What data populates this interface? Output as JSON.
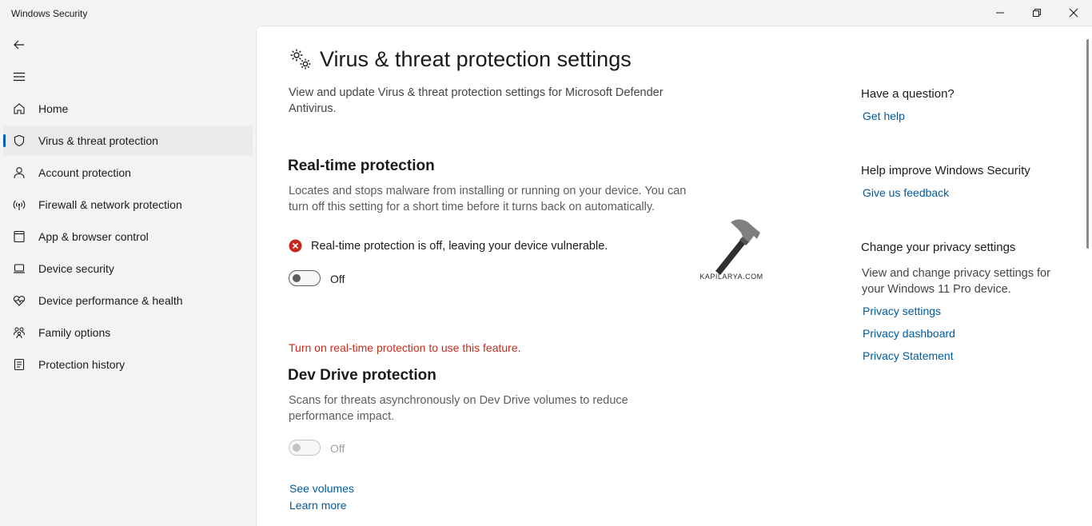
{
  "window": {
    "title": "Windows Security"
  },
  "sidebar": {
    "items": [
      {
        "label": "Home",
        "icon": "home-icon"
      },
      {
        "label": "Virus & threat protection",
        "icon": "shield-icon",
        "active": true
      },
      {
        "label": "Account protection",
        "icon": "person-icon"
      },
      {
        "label": "Firewall & network protection",
        "icon": "wifi-icon"
      },
      {
        "label": "App & browser control",
        "icon": "app-window-icon"
      },
      {
        "label": "Device security",
        "icon": "laptop-icon"
      },
      {
        "label": "Device performance & health",
        "icon": "heart-pulse-icon"
      },
      {
        "label": "Family options",
        "icon": "family-icon"
      },
      {
        "label": "Protection history",
        "icon": "history-icon"
      }
    ]
  },
  "main": {
    "title": "Virus & threat protection settings",
    "subtitle": "View and update Virus & threat protection settings for Microsoft Defender Antivirus.",
    "realtime": {
      "title": "Real-time protection",
      "description": "Locates and stops malware from installing or running on your device. You can turn off this setting for a short time before it turns back on automatically.",
      "warning": "Real-time protection is off, leaving your device vulnerable.",
      "toggle_label": "Off",
      "toggle_on": false
    },
    "note": "Turn on real-time protection to use this feature.",
    "devdrive": {
      "title": "Dev Drive protection",
      "description": "Scans for threats asynchronously on Dev Drive volumes to reduce performance impact.",
      "toggle_label": "Off",
      "toggle_on": false,
      "enabled": false
    },
    "links": {
      "see_volumes": "See volumes",
      "learn_more": "Learn more"
    },
    "watermark": "KAPILARYA.COM"
  },
  "aside": {
    "question_heading": "Have a question?",
    "get_help": "Get help",
    "improve_heading": "Help improve Windows Security",
    "feedback": "Give us feedback",
    "privacy_heading": "Change your privacy settings",
    "privacy_text": "View and change privacy settings for your Windows 11 Pro device.",
    "privacy_links": [
      "Privacy settings",
      "Privacy dashboard",
      "Privacy Statement"
    ]
  },
  "colors": {
    "accent": "#005fb8",
    "link": "#005a9e",
    "error": "#c42b1c",
    "error_icon": "#c42b1c"
  }
}
